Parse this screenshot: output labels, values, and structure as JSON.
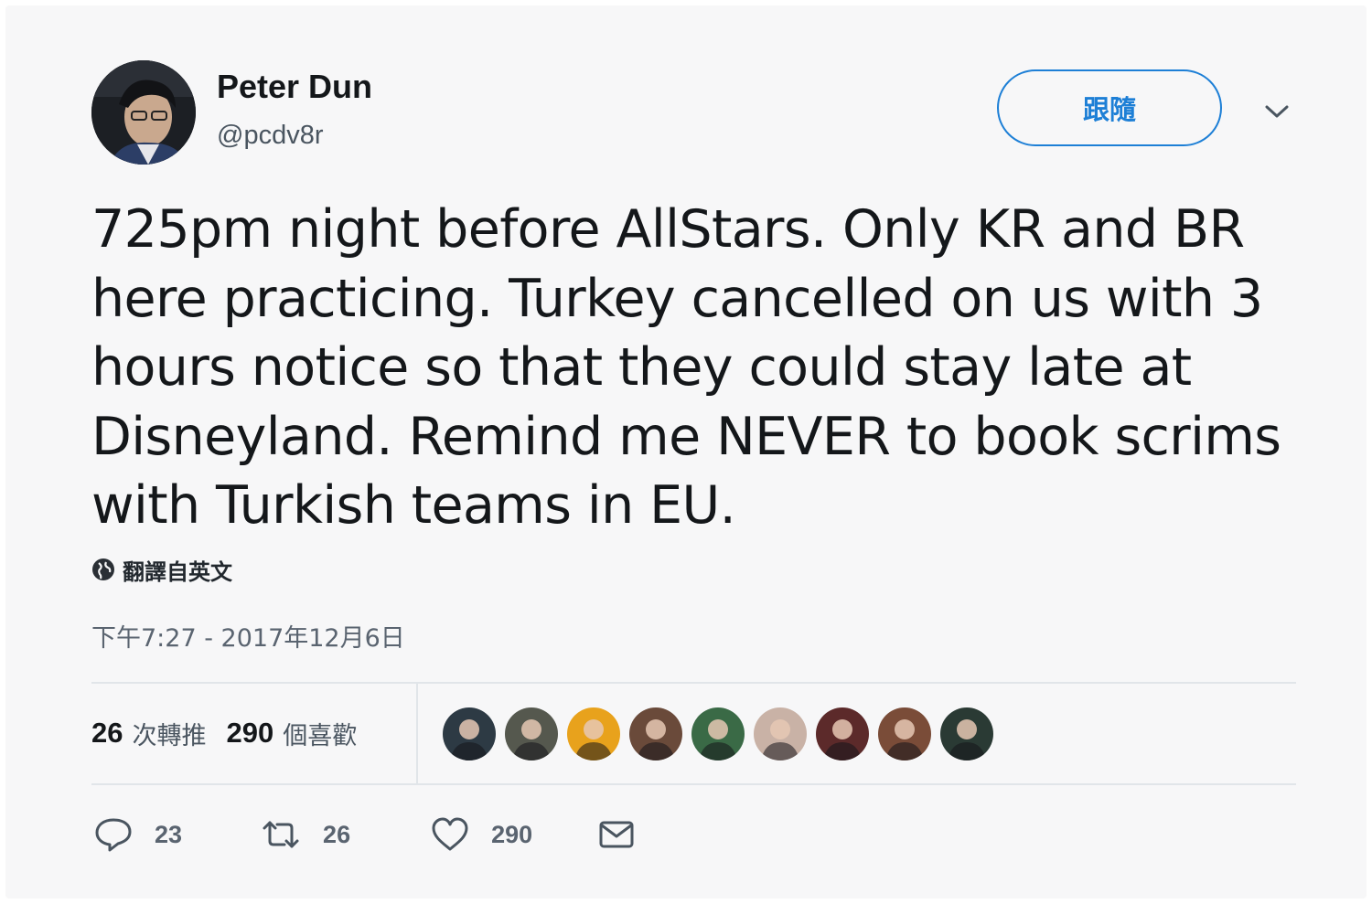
{
  "author": {
    "name": "Peter Dun",
    "handle": "@pcdv8r"
  },
  "follow_button": {
    "label": "跟隨"
  },
  "tweet": {
    "text": "725pm night before AllStars. Only KR and BR here practicing. Turkey cancelled on us with 3 hours notice so that they could stay late at Disneyland. Remind me NEVER to book scrims with Turkish teams in EU.",
    "translate_label": "翻譯自英文",
    "timestamp": "下午7:27 - 2017年12月6日"
  },
  "stats": {
    "retweets": {
      "count": "26",
      "label": "次轉推"
    },
    "likes": {
      "count": "290",
      "label": "個喜歡"
    }
  },
  "likers": [
    {
      "color": "#2d3a44"
    },
    {
      "color": "#55584e"
    },
    {
      "color": "#e8a21c"
    },
    {
      "color": "#6a4a3a"
    },
    {
      "color": "#3a6a46"
    },
    {
      "color": "#c9b2a6"
    },
    {
      "color": "#5c2a2a"
    },
    {
      "color": "#7a4c38"
    },
    {
      "color": "#2a3a34"
    }
  ],
  "actions": {
    "reply_count": "23",
    "retweet_count": "26",
    "like_count": "290"
  },
  "icons": {
    "reply": "reply-icon",
    "retweet": "retweet-icon",
    "like": "heart-icon",
    "dm": "envelope-icon",
    "globe": "globe-icon",
    "caret": "chevron-down-icon"
  },
  "colors": {
    "accent": "#1d7fd6",
    "text": "#14171a",
    "muted": "#5a6470"
  }
}
